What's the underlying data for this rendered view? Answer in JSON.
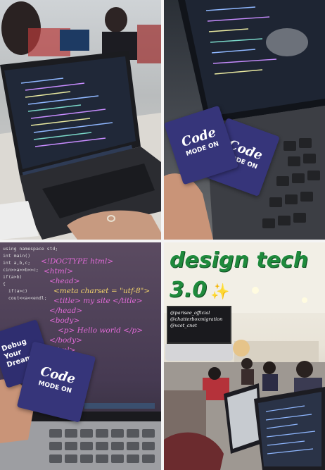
{
  "panel2": {
    "card1": {
      "line1": "Code",
      "line2": "MODE ON"
    },
    "card2": {
      "line1": "Code",
      "line2": "MODE ON"
    }
  },
  "panel3": {
    "code_left": [
      "using namespace std;",
      "int main()",
      "",
      "int a,b,c;",
      "cin>>a>>b>>c;",
      "if(a>b)",
      "{",
      "  if(a>c)",
      "",
      "",
      "  cout<<a<<endl;"
    ],
    "html_lines": [
      "<!DOCTYPE html>",
      "<html>",
      "<head>",
      "<meta charset = \"utf-8\">",
      "<title> my site </title>",
      "</head>",
      "<body>",
      "<p> Hello world </p>",
      "</body>",
      "</html>"
    ],
    "card_debug": "Debug Your Dream",
    "card_code": {
      "line1": "Code",
      "line2": "MODE ON"
    }
  },
  "panel4": {
    "title_line1": "design tech",
    "title_line2": "3.0",
    "sparkle": "✨",
    "screen_lines": [
      "@parisee_official",
      "@chatterboxmigration",
      "@vcet_cnet"
    ]
  },
  "colors": {
    "card": "#36357a",
    "title_green": "#1f8a3c",
    "code_pink": "#e26bd8",
    "code_yellow": "#f2d36b"
  }
}
